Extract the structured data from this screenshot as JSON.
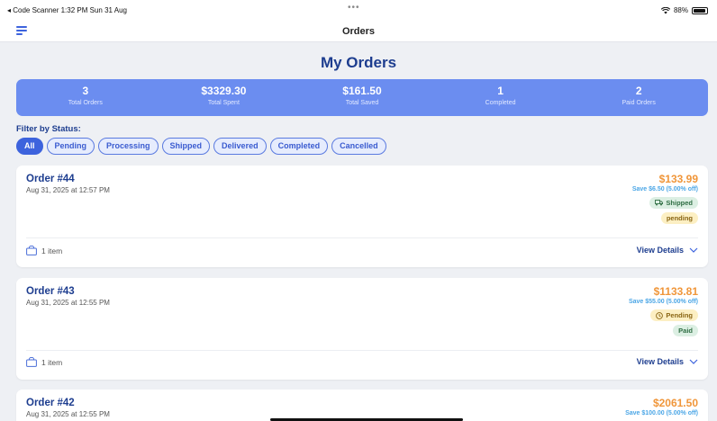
{
  "status_bar": {
    "left": "◂ Code Scanner  1:32 PM  Sun 31 Aug",
    "dots": "•••",
    "battery": "88%"
  },
  "nav": {
    "title": "Orders"
  },
  "page": {
    "title": "My Orders"
  },
  "stats": [
    {
      "value": "3",
      "label": "Total Orders"
    },
    {
      "value": "$3329.30",
      "label": "Total Spent"
    },
    {
      "value": "$161.50",
      "label": "Total Saved"
    },
    {
      "value": "1",
      "label": "Completed"
    },
    {
      "value": "2",
      "label": "Paid Orders"
    }
  ],
  "filter": {
    "label": "Filter by Status:",
    "chips": [
      "All",
      "Pending",
      "Processing",
      "Shipped",
      "Delivered",
      "Completed",
      "Cancelled"
    ],
    "active": "All"
  },
  "orders": [
    {
      "id": "Order #44",
      "date": "Aug 31, 2025 at 12:57 PM",
      "price": "$133.99",
      "save": "Save $6.50 (5.00% off)",
      "status": "Shipped",
      "status_icon": "truck-icon",
      "payment": "pending",
      "items": "1 item",
      "view": "View Details"
    },
    {
      "id": "Order #43",
      "date": "Aug 31, 2025 at 12:55 PM",
      "price": "$1133.81",
      "save": "Save $55.00 (5.00% off)",
      "status": "Pending",
      "status_icon": "clock-icon",
      "payment": "Paid",
      "items": "1 item",
      "view": "View Details"
    },
    {
      "id": "Order #42",
      "date": "Aug 31, 2025 at 12:55 PM",
      "price": "$2061.50",
      "save": "Save $100.00 (5.00% off)"
    }
  ],
  "colors": {
    "accent": "#3d63dd",
    "stats_bg": "#6b8df0",
    "price": "#f0963a",
    "save": "#4ba6e6",
    "heading": "#1d3d8f"
  }
}
